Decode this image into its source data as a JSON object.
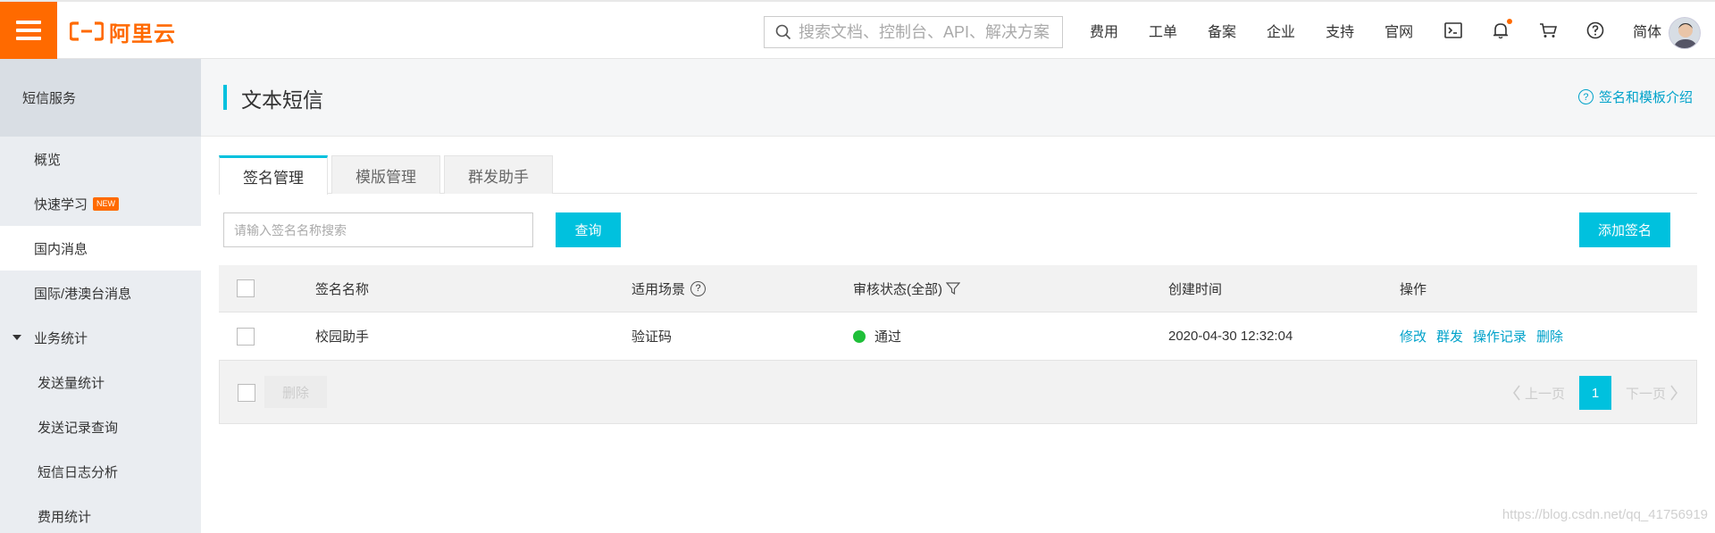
{
  "topbar": {
    "logo_text": "阿里云",
    "search_placeholder": "搜索文档、控制台、API、解决方案",
    "nav": [
      "费用",
      "工单",
      "备案",
      "企业",
      "支持",
      "官网"
    ],
    "lang": "简体",
    "brand_color": "#ff6a00"
  },
  "sidebar": {
    "title": "短信服务",
    "items": [
      {
        "label": "概览"
      },
      {
        "label": "快速学习",
        "badge": "NEW"
      },
      {
        "label": "国内消息"
      },
      {
        "label": "国际/港澳台消息"
      },
      {
        "label": "业务统计"
      },
      {
        "label": "发送量统计"
      },
      {
        "label": "发送记录查询"
      },
      {
        "label": "短信日志分析"
      },
      {
        "label": "费用统计"
      }
    ]
  },
  "main": {
    "title": "文本短信",
    "help_link": "签名和模板介绍",
    "tabs": [
      "签名管理",
      "模版管理",
      "群发助手"
    ],
    "filter": {
      "placeholder": "请输入签名名称搜索",
      "query_button": "查询",
      "add_button": "添加签名"
    },
    "table": {
      "headers": [
        "签名名称",
        "适用场景",
        "审核状态(全部)",
        "创建时间",
        "操作"
      ],
      "rows": [
        {
          "name": "校园助手",
          "scene": "验证码",
          "status": "通过",
          "created": "2020-04-30 12:32:04",
          "ops": [
            "修改",
            "群发",
            "操作记录",
            "删除"
          ]
        }
      ]
    },
    "footer": {
      "delete_button": "删除",
      "prev": "上一页",
      "page": "1",
      "next": "下一页"
    },
    "accent_color": "#00c1de",
    "status_color": "#1fbf39"
  },
  "watermark": "https://blog.csdn.net/qq_41756919"
}
